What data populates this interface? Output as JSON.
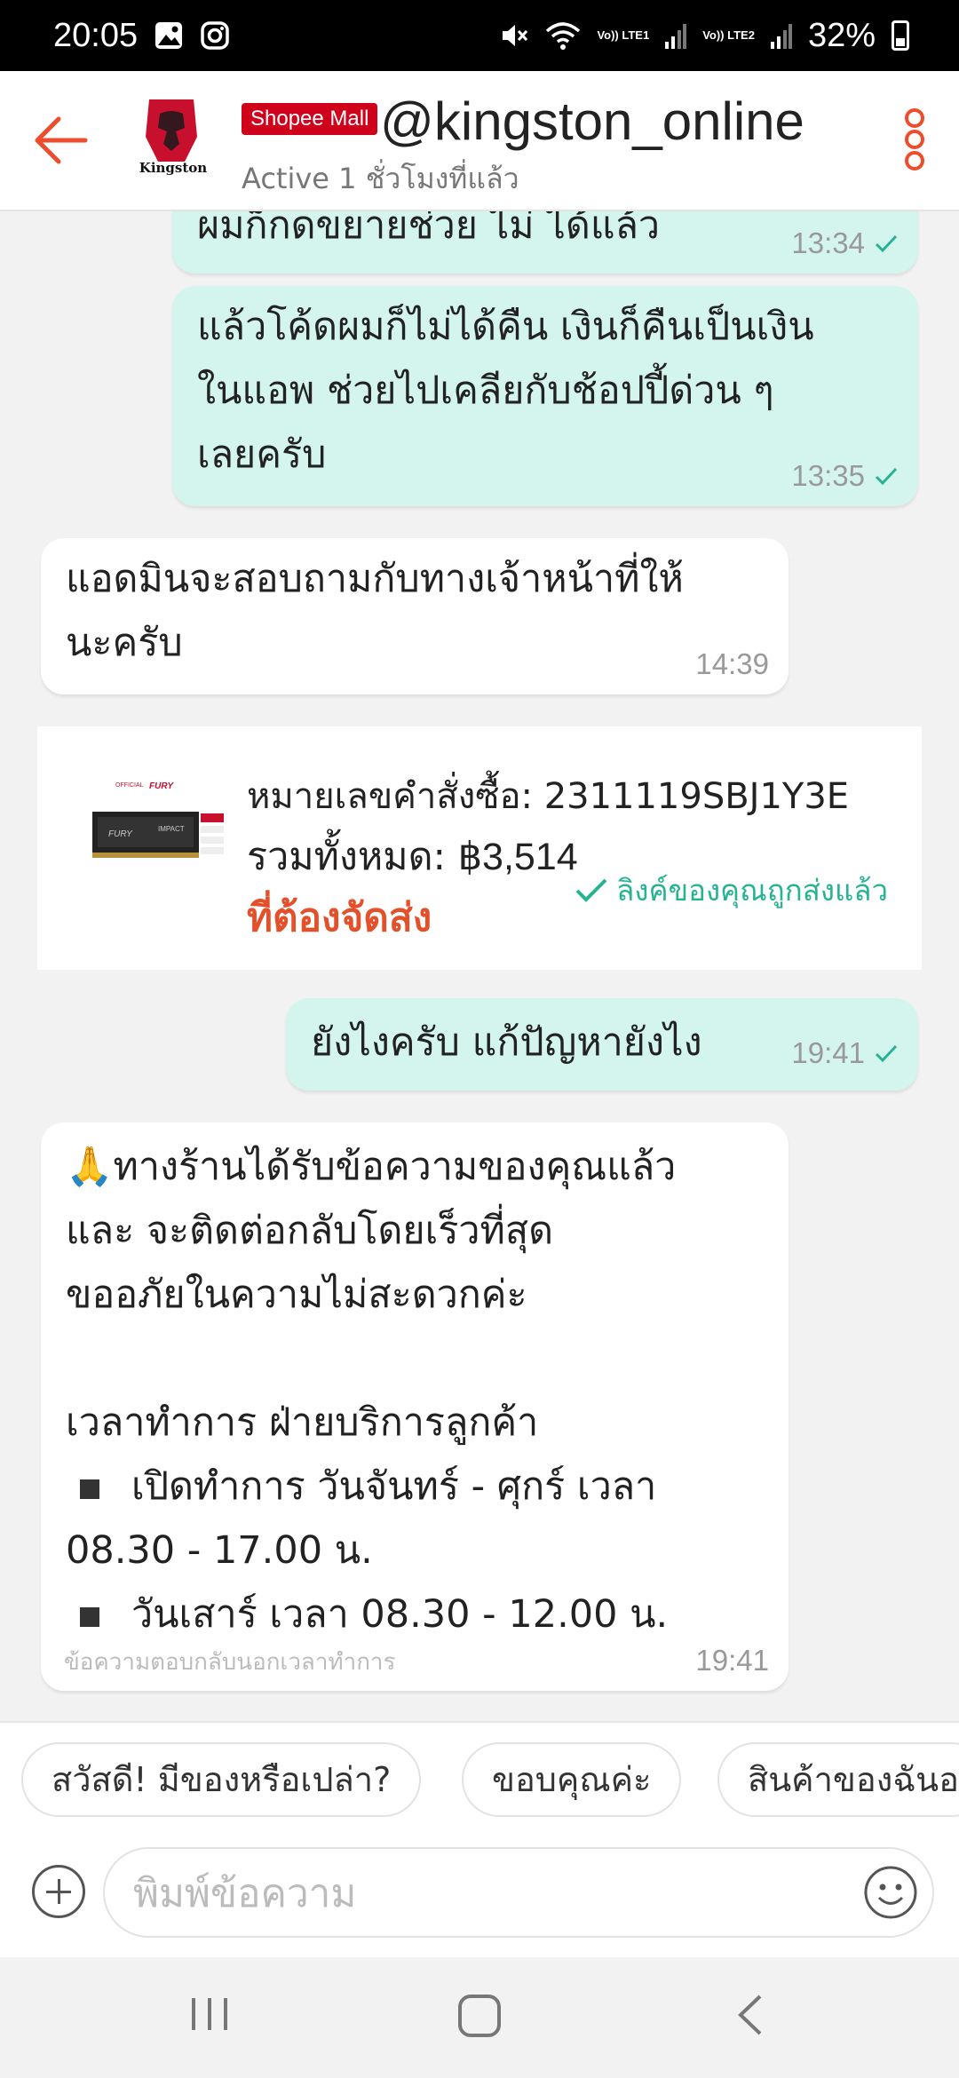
{
  "status_bar": {
    "time": "20:05",
    "net1": "Vo)) LTE1",
    "net2": "Vo)) LTE2",
    "battery": "32%"
  },
  "header": {
    "badge": "Shopee Mall",
    "shop_name": "@kingston_online",
    "active_status": "Active 1 ชั่วโมงที่แล้ว",
    "logo_text": "Kingston"
  },
  "messages": [
    {
      "text": "ผมก็กดขยายช่วย ไม่ ได้แล้ว",
      "time": "13:34"
    },
    {
      "lines": [
        "แล้วโค้ดผมก็ไม่ได้คืน เงินก็คืนเป็นเงิน",
        "ในแอพ ช่วยไปเคลียกับช้อปปี้ด่วน ๆ",
        "เลยครับ"
      ],
      "time": "13:35"
    },
    {
      "lines": [
        "แอดมินจะสอบถามกับทางเจ้าหน้าที่ให้",
        "นะครับ"
      ],
      "time": "14:39"
    },
    {
      "text": "ยังไงครับ แก้ปัญหายังไง",
      "time": "19:41"
    }
  ],
  "order": {
    "number_label": "หมายเลขคำสั่งซื้อ: 2311119SBJ1Y3E",
    "total_label": "รวมทั้งหมด: ",
    "total_value": "฿3,514",
    "status": "ที่ต้องจัดส่ง",
    "link_sent": "ลิงค์ของคุณถูกส่งแล้ว"
  },
  "auto_reply": {
    "emoji": "🙏",
    "lines": [
      "ทางร้านได้รับข้อความของคุณแล้ว",
      "และ จะติดต่อกลับโดยเร็วที่สุด",
      "ขออภัยในความไม่สะดวกค่ะ",
      "เวลาทำการ ฝ่ายบริการลูกค้า",
      "เปิดทำการ วันจันทร์ - ศุกร์  เวลา",
      "08.30 - 17.00 น.",
      "วันเสาร์ เวลา 08.30 - 12.00 น."
    ],
    "footnote": "ข้อความตอบกลับนอกเวลาทำการ",
    "time": "19:41"
  },
  "quick_replies": [
    "สวัสดี! มีของหรือเปล่า?",
    "ขอบคุณค่ะ",
    "สินค้าของฉันอ"
  ],
  "composer": {
    "placeholder": "พิมพ์ข้อความ"
  },
  "colors": {
    "accent": "#ee4d2d",
    "sent_bubble": "#d4f5ee",
    "order_status": "#e4502a",
    "link_green": "#26b391",
    "mall_red": "#d0011b"
  }
}
